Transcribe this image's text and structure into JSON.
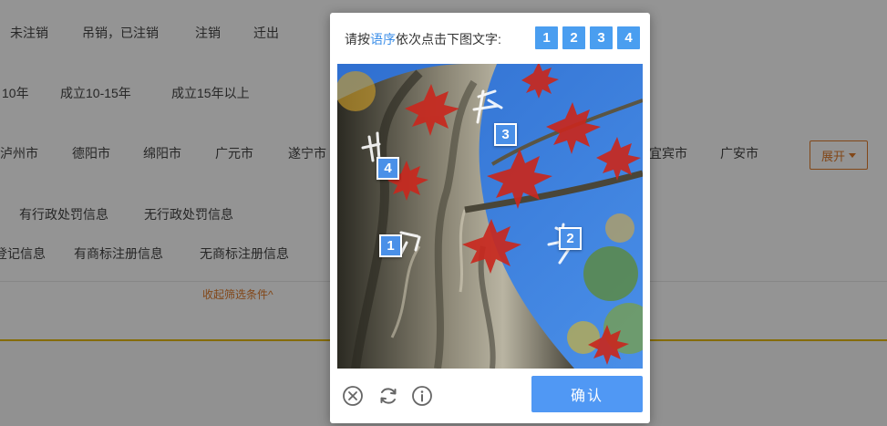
{
  "background": {
    "status_row": [
      "未注销",
      "吊销，已注销",
      "注销",
      "迁出"
    ],
    "age_row": [
      "10年",
      "成立10-15年",
      "成立15年以上"
    ],
    "city_row": [
      "泸州市",
      "德阳市",
      "绵阳市",
      "广元市",
      "遂宁市",
      "宜宾市",
      "广安市"
    ],
    "expand_label": "展开",
    "penalty_row": [
      "有行政处罚信息",
      "无行政处罚信息"
    ],
    "trademark_row": [
      "登记信息",
      "有商标注册信息",
      "无商标注册信息"
    ],
    "collapse_label": "收起筛选条件^"
  },
  "captcha": {
    "prompt_prefix": "请按",
    "prompt_highlight": "语序",
    "prompt_suffix": "依次点击下图文字:",
    "order": [
      "1",
      "2",
      "3",
      "4"
    ],
    "markers": [
      "1",
      "2",
      "3",
      "4"
    ],
    "confirm_label": "确认",
    "icons": [
      "close-icon",
      "refresh-icon",
      "info-icon"
    ],
    "colors": {
      "accent": "#4a9ef0",
      "highlight": "#3b8ee8"
    }
  }
}
